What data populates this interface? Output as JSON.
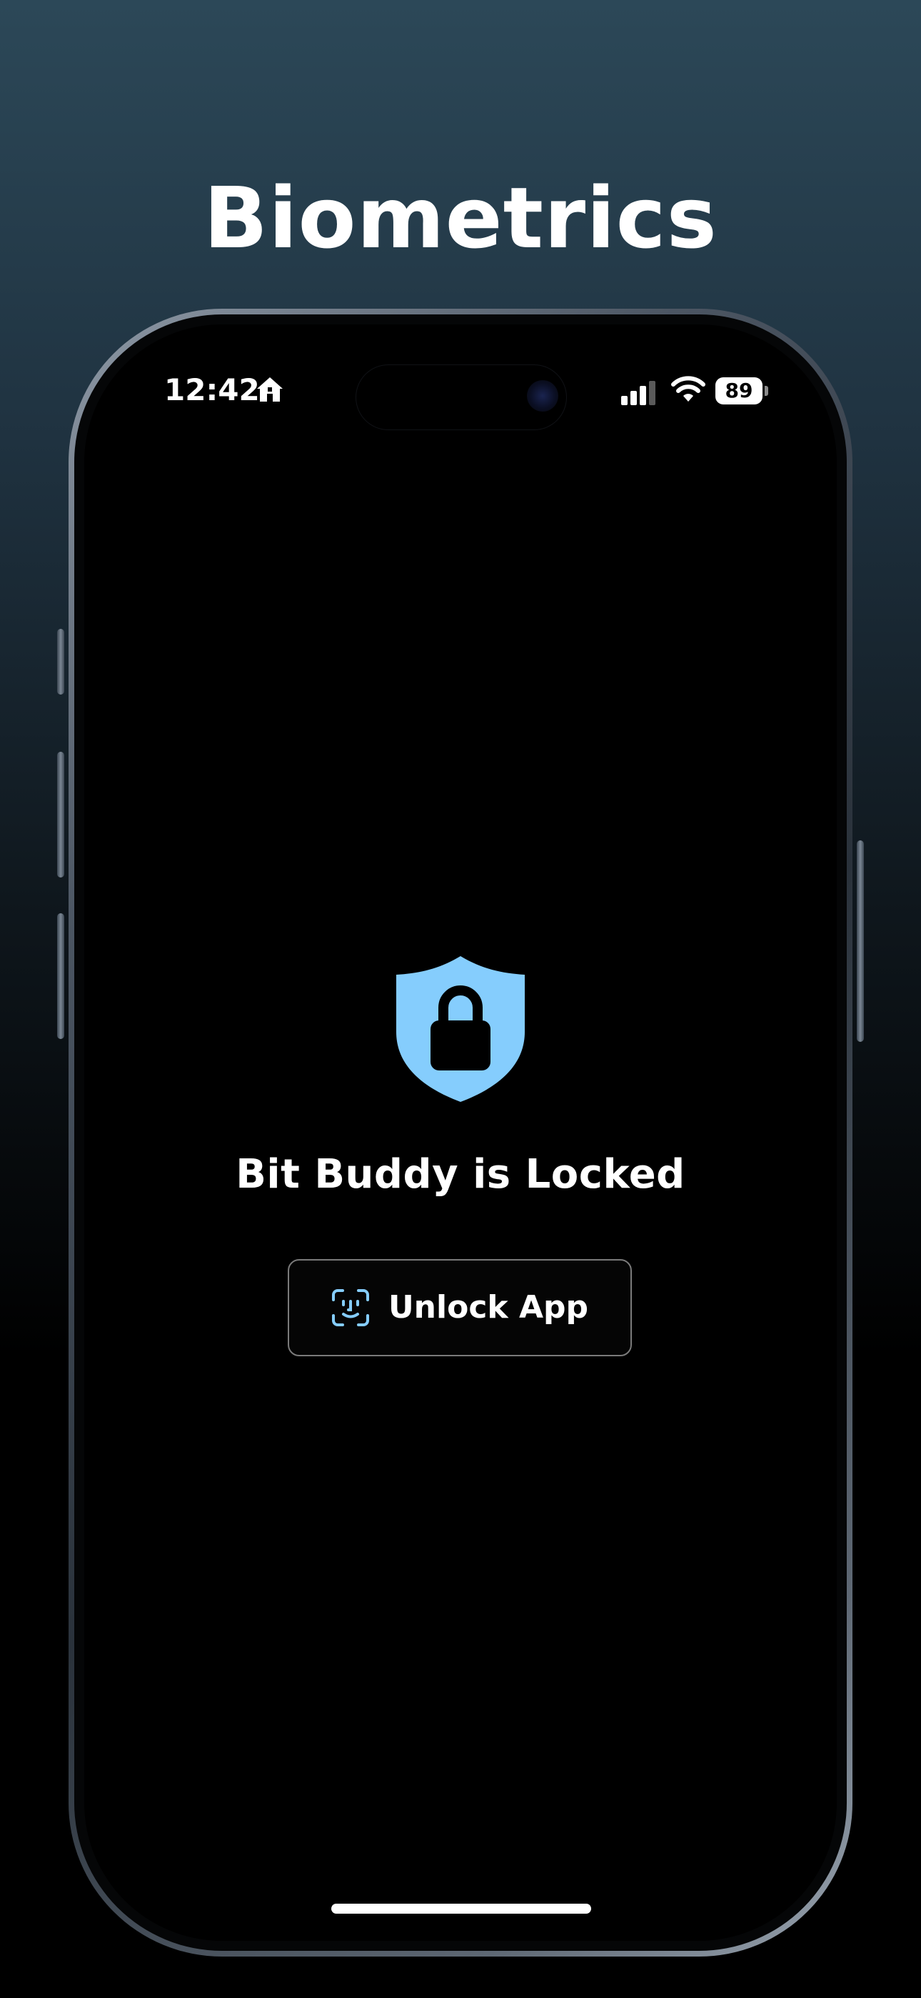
{
  "headline": "Biometrics",
  "status_bar": {
    "time": "12:42",
    "battery_level": "89",
    "icons": [
      "home-icon",
      "cellular-signal-icon",
      "wifi-icon",
      "battery-icon"
    ]
  },
  "lock_screen": {
    "icon": "shield-lock-icon",
    "title": "Bit Buddy is Locked",
    "unlock_button": {
      "icon": "face-id-icon",
      "label": "Unlock App"
    }
  },
  "colors": {
    "accent": "#85cdfd",
    "background": "#000000",
    "text": "#ffffff",
    "gradient_top": "#2c4858"
  }
}
